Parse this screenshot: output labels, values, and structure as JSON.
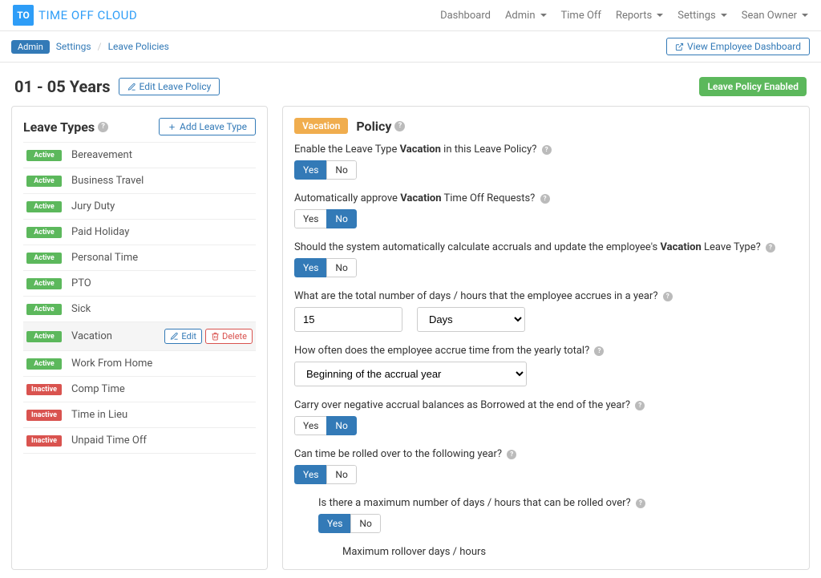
{
  "brand": {
    "logo_initials": "TO",
    "product_name": "TIME OFF CLOUD"
  },
  "nav": {
    "dashboard": "Dashboard",
    "admin": "Admin",
    "timeoff": "Time Off",
    "reports": "Reports",
    "settings": "Settings",
    "user": "Sean Owner"
  },
  "breadcrumb": {
    "root": "Admin",
    "settings": "Settings",
    "page": "Leave Policies",
    "view_dashboard": "View Employee Dashboard"
  },
  "title_bar": {
    "title": "01 - 05 Years",
    "edit_label": "Edit Leave Policy",
    "status": "Leave Policy Enabled"
  },
  "leave_types_panel": {
    "title": "Leave Types",
    "add_label": "Add Leave Type",
    "status_active": "Active",
    "status_inactive": "Inactive",
    "edit_label": "Edit",
    "delete_label": "Delete",
    "items": [
      {
        "label": "Bereavement",
        "status": "Active"
      },
      {
        "label": "Business Travel",
        "status": "Active"
      },
      {
        "label": "Jury Duty",
        "status": "Active"
      },
      {
        "label": "Paid Holiday",
        "status": "Active"
      },
      {
        "label": "Personal Time",
        "status": "Active"
      },
      {
        "label": "PTO",
        "status": "Active"
      },
      {
        "label": "Sick",
        "status": "Active"
      },
      {
        "label": "Vacation",
        "status": "Active"
      },
      {
        "label": "Work From Home",
        "status": "Active"
      },
      {
        "label": "Comp Time",
        "status": "Inactive"
      },
      {
        "label": "Time in Lieu",
        "status": "Inactive"
      },
      {
        "label": "Unpaid Time Off",
        "status": "Inactive"
      }
    ]
  },
  "policy_panel": {
    "tag": "Vacation",
    "title": "Policy",
    "yes": "Yes",
    "no": "No",
    "q_enable_pre": "Enable the Leave Type ",
    "q_enable_bold": "Vacation",
    "q_enable_post": " in this Leave Policy?",
    "enable_value": "Yes",
    "q_auto_pre": "Automatically approve ",
    "q_auto_bold": "Vacation",
    "q_auto_post": " Time Off Requests?",
    "auto_value": "No",
    "q_accrual_pre": "Should the system automatically calculate accruals and update the employee's ",
    "q_accrual_bold": "Vacation",
    "q_accrual_post": " Leave Type?",
    "accrual_value": "Yes",
    "q_total": "What are the total number of days / hours that the employee accrues in a year?",
    "total_value": "15",
    "total_unit": "Days",
    "q_freq": "How often does the employee accrue time from the yearly total?",
    "freq_value": "Beginning of the accrual year",
    "q_carry_neg": "Carry over negative accrual balances as Borrowed at the end of the year?",
    "carry_neg_value": "No",
    "q_rollover": "Can time be rolled over to the following year?",
    "rollover_value": "Yes",
    "q_max_roll": "Is there a maximum number of days / hours that can be rolled over?",
    "max_roll_value": "Yes",
    "q_max_roll_amount": "Maximum rollover days / hours"
  }
}
